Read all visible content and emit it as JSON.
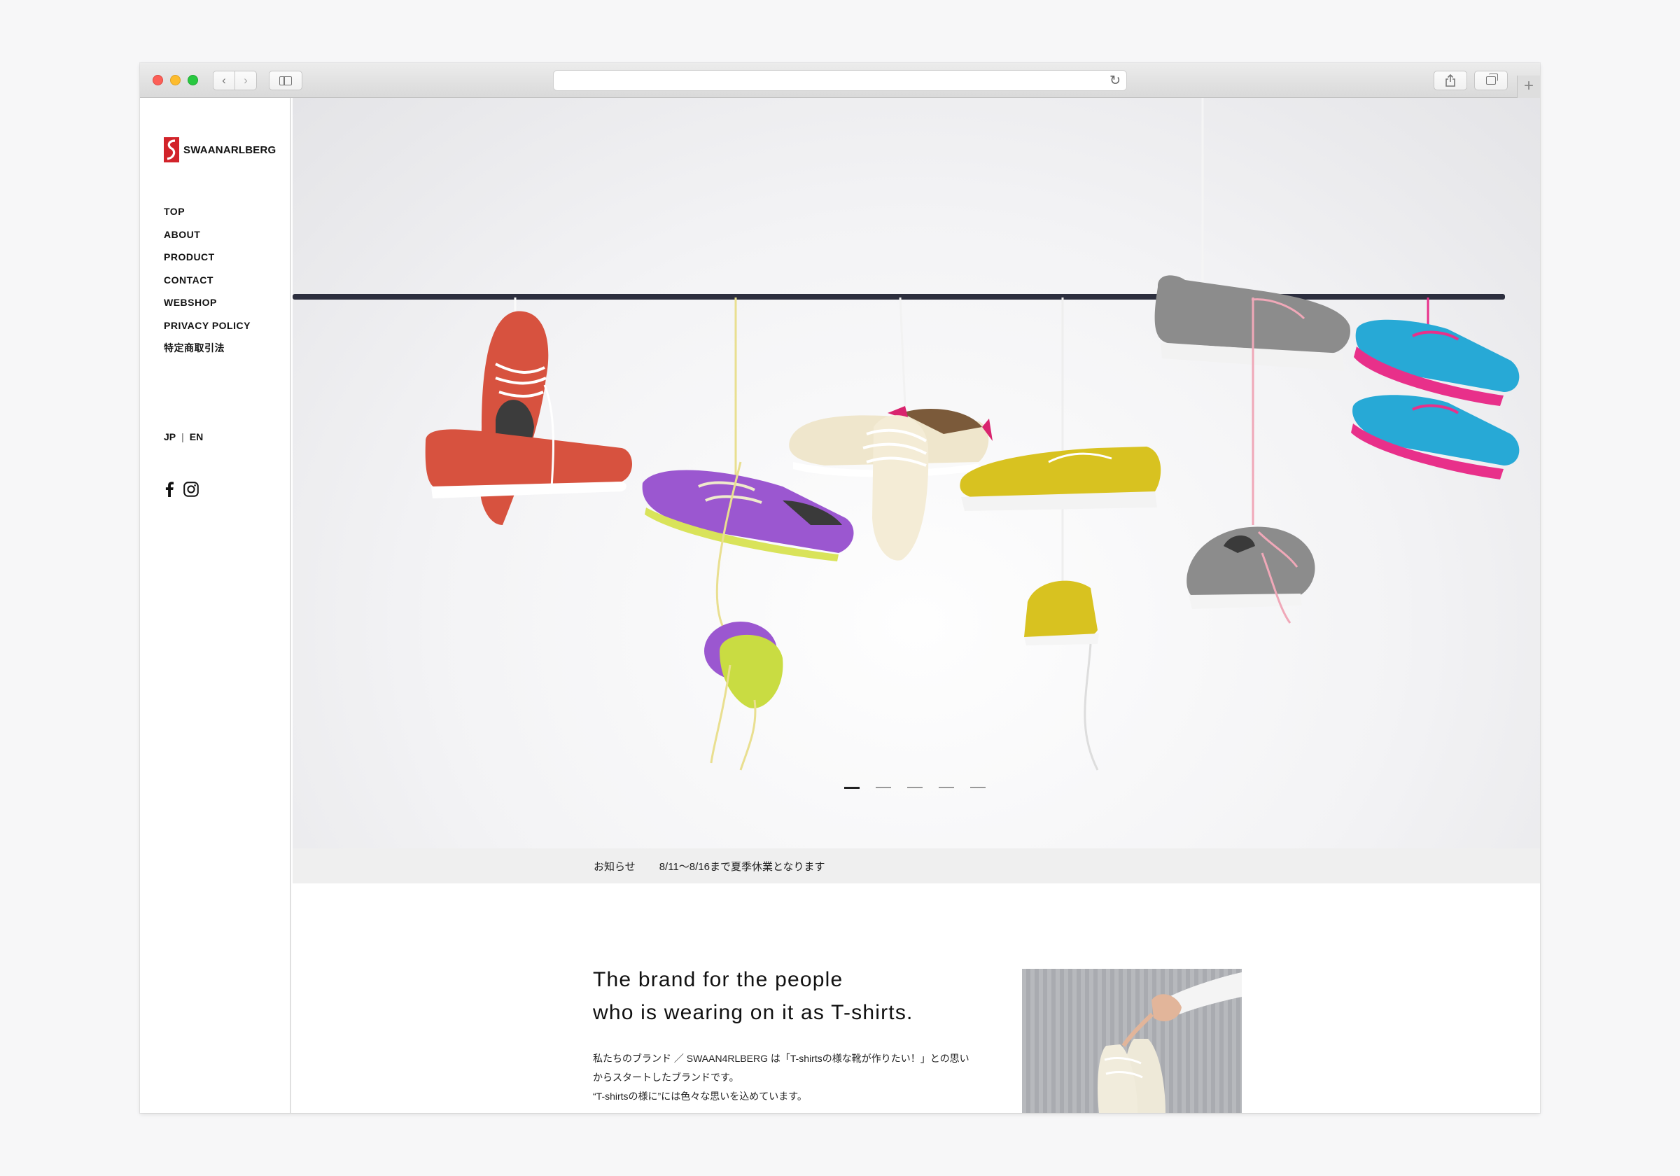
{
  "browser": {
    "address_text": "",
    "buttons": [
      "back",
      "forward",
      "sidebar",
      "reload",
      "share",
      "tabs",
      "new-tab"
    ]
  },
  "sidebar": {
    "logo_text": "SWAANARLBERG",
    "menu": [
      "TOP",
      "ABOUT",
      "PRODUCT",
      "CONTACT",
      "WEBSHOP",
      "PRIVACY POLICY",
      "特定商取引法"
    ],
    "lang": {
      "jp": "JP",
      "sep": "|",
      "en": "EN"
    },
    "social": [
      "facebook-icon",
      "instagram-icon"
    ]
  },
  "hero": {
    "slide_count": 5,
    "active_slide": 1
  },
  "news": {
    "label": "お知らせ",
    "text": "8/11〜8/16まで夏季休業となります"
  },
  "intro": {
    "title_line1": "The brand for the people",
    "title_line2": "who is wearing on it as T-shirts.",
    "body_line1": "私たちのブランド ／ SWAAN4RLBERG は「T-shirtsの様な靴が作りたい！」との思い",
    "body_line2": "からスタートしたブランドです。",
    "body_line3": "“T-shirtsの様に”には色々な思いを込めています。"
  },
  "colors": {
    "brand_red": "#d2232a",
    "news_bg": "#efefef",
    "shoe_colors": [
      "#d7523f",
      "#9b57d0",
      "#efe6cc",
      "#d8c220",
      "#8c8c8c",
      "#27a9d6"
    ]
  }
}
